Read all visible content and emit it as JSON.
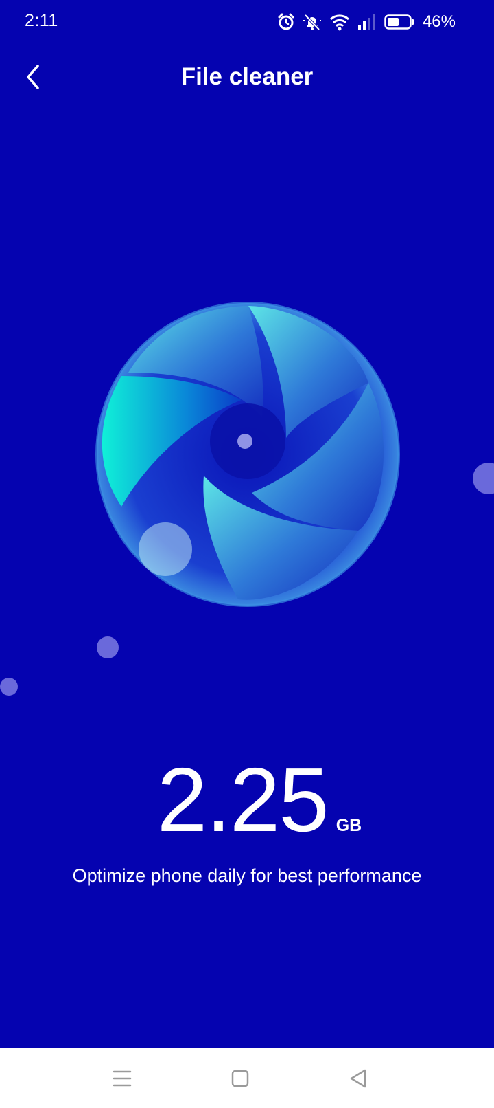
{
  "status_bar": {
    "time": "2:11",
    "battery_percent": "46%",
    "icons": [
      "alarm-icon",
      "bell-muted-icon",
      "wifi-icon",
      "signal-icon",
      "battery-icon"
    ]
  },
  "header": {
    "title": "File cleaner",
    "back_icon": "chevron-left-icon"
  },
  "storage": {
    "value": "2.25",
    "unit": "GB"
  },
  "hint": "Optimize phone daily for best performance",
  "nav_bar": {
    "icons": [
      "menu-icon",
      "home-icon",
      "back-icon"
    ]
  },
  "colors": {
    "background": "#0503b0",
    "accent_cyan": "#10f0d8",
    "nav_background": "#ffffff"
  }
}
